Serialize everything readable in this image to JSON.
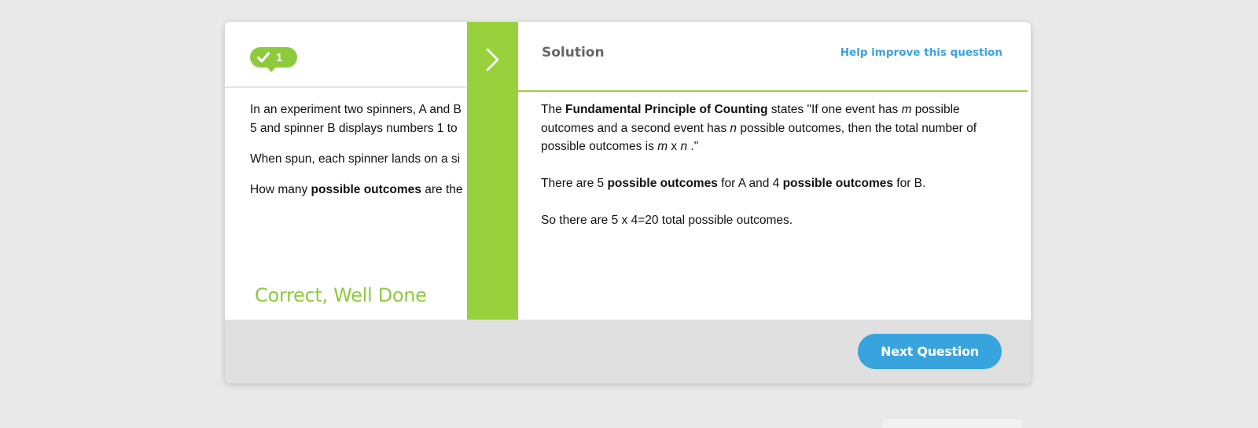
{
  "question": {
    "streak_count": "1",
    "line1": "In an experiment two spinners, A and B",
    "line2": "5 and spinner B displays numbers 1 to",
    "paragraph2": "When spun, each spinner lands on a si",
    "paragraph3_pre": "How many ",
    "paragraph3_bold": "possible outcomes",
    "paragraph3_post": " are the",
    "feedback": "Correct, Well Done"
  },
  "solution": {
    "title": "Solution",
    "help_link": "Help improve this question",
    "p1_pre": "The ",
    "p1_bold": "Fundamental Principle of Counting",
    "p1_a": " states \"If one event has ",
    "p1_m": "m",
    "p1_b": " possible outcomes and a second event has ",
    "p1_n": "n",
    "p1_c": " possible outcomes, then the total number of possible outcomes is ",
    "p1_m2": "m",
    "p1_x": " x ",
    "p1_n2": "n",
    "p1_end": " .\"",
    "p2_a": "There are 5 ",
    "p2_bold1": "possible outcomes",
    "p2_b": " for A and 4 ",
    "p2_bold2": "possible outcomes",
    "p2_c": " for B.",
    "p3": "So there are 5 x 4=20  total possible outcomes."
  },
  "footer": {
    "next_label": "Next Question"
  },
  "colors": {
    "accent_green": "#98d13c",
    "badge_green": "#8dcb3c",
    "link_blue": "#3aa3dc",
    "button_blue": "#37a4de"
  },
  "icons": {
    "streak": "check-icon",
    "toggle": "chevron-right-icon"
  }
}
